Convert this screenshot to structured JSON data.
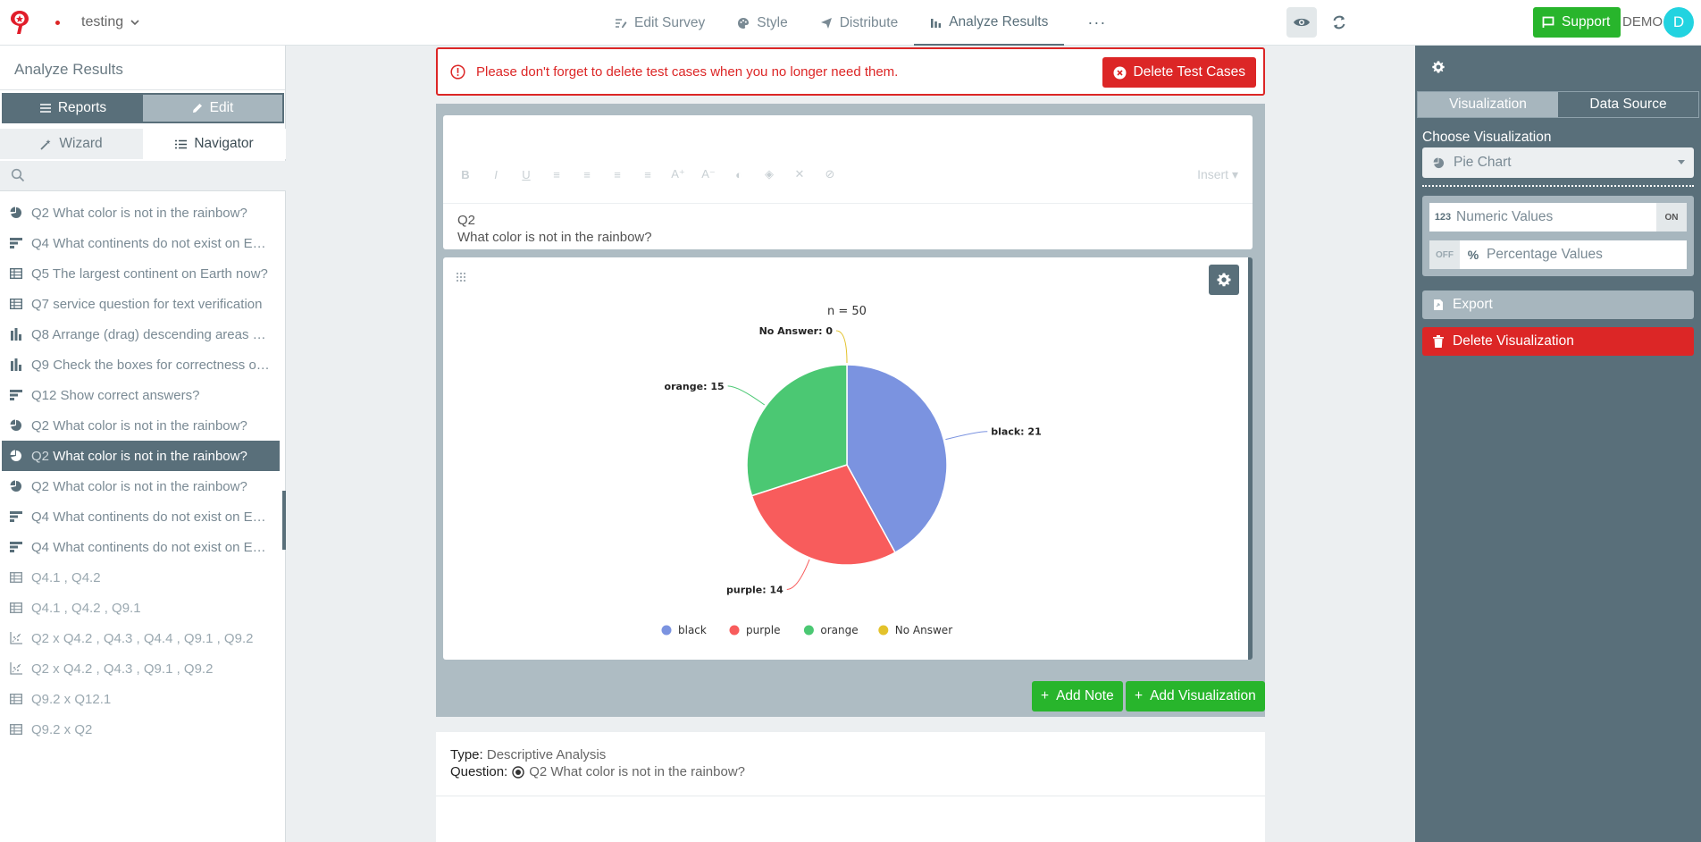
{
  "header": {
    "project_name": "testing",
    "nav": [
      {
        "label": "Edit Survey",
        "icon": "edit-survey-icon"
      },
      {
        "label": "Style",
        "icon": "palette-icon"
      },
      {
        "label": "Distribute",
        "icon": "send-icon"
      },
      {
        "label": "Analyze Results",
        "icon": "bar-chart-icon",
        "active": true
      }
    ],
    "more": "···",
    "support_label": "Support",
    "user_label": "DEMO",
    "avatar_initial": "D"
  },
  "sidebar": {
    "title": "Analyze Results",
    "mode_reports": "Reports",
    "mode_edit": "Edit",
    "tab_wizard": "Wizard",
    "tab_navigator": "Navigator",
    "search_placeholder": "",
    "items": [
      {
        "num": "Q2",
        "text": "What color is not in the rainbow?",
        "icon": "pie-icon"
      },
      {
        "num": "Q4",
        "text": "What continents do not exist on Earth ...",
        "icon": "hbar-icon"
      },
      {
        "num": "Q5",
        "text": "The largest continent on Earth now?",
        "icon": "table-icon"
      },
      {
        "num": "Q7",
        "text": "service question for text verification",
        "icon": "table-icon"
      },
      {
        "num": "Q8",
        "text": "Arrange (drag) descending areas of the...",
        "icon": "vbar-icon"
      },
      {
        "num": "Q9",
        "text": "Check the boxes for correctness of the...",
        "icon": "vbar-icon"
      },
      {
        "num": "Q12",
        "text": "Show correct answers?",
        "icon": "hbar-icon"
      },
      {
        "num": "Q2",
        "text": "What color is not in the rainbow?",
        "icon": "pie-icon"
      },
      {
        "num": "Q2",
        "text": "What color is not in the rainbow?",
        "icon": "pie-icon",
        "selected": true
      },
      {
        "num": "Q2",
        "text": "What color is not in the rainbow?",
        "icon": "pie-icon"
      },
      {
        "num": "Q4",
        "text": "What continents do not exist on Earth ...",
        "icon": "hbar-icon"
      },
      {
        "num": "Q4",
        "text": "What continents do not exist on Earth ...",
        "icon": "hbar-icon"
      },
      {
        "num": "",
        "text": "Q4.1 , Q4.2",
        "icon": "table-icon",
        "dim": true
      },
      {
        "num": "",
        "text": "Q4.1 , Q4.2 , Q9.1",
        "icon": "table-icon",
        "dim": true
      },
      {
        "num": "",
        "text": "Q2 x Q4.2 , Q4.3 , Q4.4 , Q9.1 , Q9.2",
        "icon": "scatter-icon",
        "dim": true
      },
      {
        "num": "",
        "text": "Q2 x Q4.2 , Q4.3 , Q9.1 , Q9.2",
        "icon": "scatter-icon",
        "dim": true
      },
      {
        "num": "",
        "text": "Q9.2 x Q12.1",
        "icon": "table-icon",
        "dim": true
      },
      {
        "num": "",
        "text": "Q9.2 x Q2",
        "icon": "table-icon",
        "dim": true
      }
    ]
  },
  "alert": {
    "message": "Please don't forget to delete test cases when you no longer need them.",
    "button": "Delete Test Cases"
  },
  "note": {
    "toolbar": [
      "B",
      "I",
      "U",
      "≡",
      "≡",
      "≡",
      "≡",
      "A⁺",
      "A⁻",
      "◐",
      "◈",
      "✕",
      "⊘"
    ],
    "insert_label": "Insert",
    "question_num": "Q2",
    "question_text": "What color is not in the rainbow?"
  },
  "chart_data": {
    "type": "pie",
    "title": "n = 50",
    "categories": [
      "black",
      "purple",
      "orange",
      "No Answer"
    ],
    "values": [
      21,
      14,
      15,
      0
    ],
    "colors": [
      "#7b93e0",
      "#f85c5c",
      "#4bc873",
      "#e3c22b"
    ],
    "slice_labels": [
      "black: 21",
      "purple: 14",
      "orange: 15",
      "No Answer: 0"
    ],
    "legend_position": "bottom"
  },
  "actions": {
    "add_note": "Add Note",
    "add_visualization": "Add Visualization"
  },
  "info": {
    "type_label": "Type:",
    "type_value": "Descriptive Analysis",
    "question_label": "Question:",
    "question_value": "Q2 What color is not in the rainbow?"
  },
  "right": {
    "tab_visualization": "Visualization",
    "tab_data_source": "Data Source",
    "choose_label": "Choose Visualization",
    "selected_viz": "Pie Chart",
    "numeric_label": "Numeric Values",
    "numeric_state": "ON",
    "numeric_icon": "123",
    "percentage_label": "Percentage Values",
    "percentage_state": "OFF",
    "export_label": "Export",
    "delete_label": "Delete Visualization"
  }
}
